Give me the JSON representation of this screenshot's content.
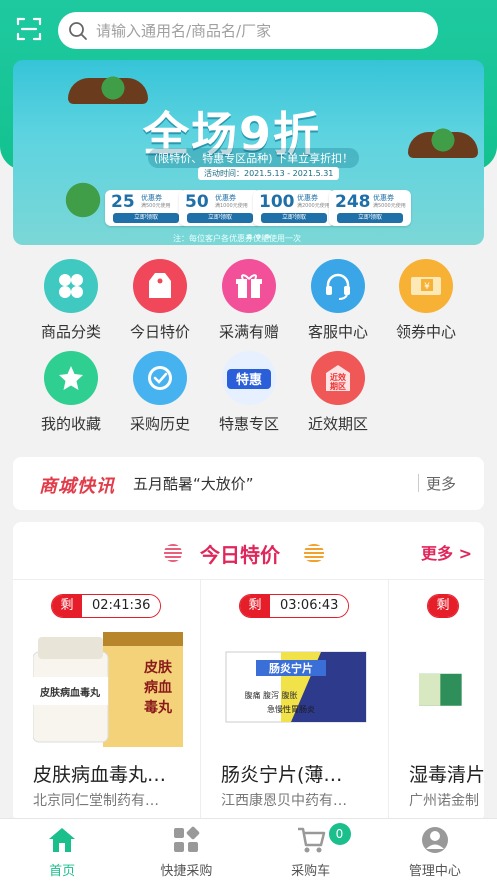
{
  "header": {
    "search_placeholder": "请输入通用名/商品名/厂家"
  },
  "banner": {
    "title": "全场9折",
    "subtitle": "(限特价、特惠专区品种) 下单立享折扣！",
    "date": "活动时间：2021.5.13 - 2021.5.31",
    "coupons": [
      {
        "amount": "25",
        "desc": "优惠券",
        "cond": "满500元使用",
        "btn": "立即领取"
      },
      {
        "amount": "50",
        "desc": "优惠券",
        "cond": "满1000元使用",
        "btn": "立即领取"
      },
      {
        "amount": "100",
        "desc": "优惠券",
        "cond": "满2000元使用",
        "btn": "立即领取"
      },
      {
        "amount": "248",
        "desc": "优惠券",
        "cond": "满5000元使用",
        "btn": "立即领取"
      }
    ],
    "note": "注：每位客户各优惠券仅能使用一次"
  },
  "menu": [
    {
      "label": "商品分类",
      "icon": "grid-icon",
      "color": "#3fc9c0"
    },
    {
      "label": "今日特价",
      "icon": "tag-icon",
      "color": "#f0475a"
    },
    {
      "label": "采满有赠",
      "icon": "gift-icon",
      "color": "#f2519a"
    },
    {
      "label": "客服中心",
      "icon": "headset-icon",
      "color": "#3aa6e8"
    },
    {
      "label": "领券中心",
      "icon": "ticket-icon",
      "color": "#f7b236"
    },
    {
      "label": "我的收藏",
      "icon": "star-icon",
      "color": "#2fcf92"
    },
    {
      "label": "采购历史",
      "icon": "clock-icon",
      "color": "#46b3f0"
    },
    {
      "label": "特惠专区",
      "icon": "special-icon",
      "color": "#2b5fd9"
    },
    {
      "label": "近效期区",
      "icon": "near-expiry-icon",
      "color": "#f05757"
    }
  ],
  "news": {
    "logo": "商城快讯",
    "text": "五月酷暑“大放价”",
    "more": "更多"
  },
  "special": {
    "title": "今日特价",
    "more": "更多 >",
    "tag": "剩",
    "products": [
      {
        "time": "02:41:36",
        "name": "皮肤病血毒丸…",
        "maker": "北京同仁堂制药有…",
        "img_text": "皮肤病血毒丸"
      },
      {
        "time": "03:06:43",
        "name": "肠炎宁片(薄…",
        "maker": "江西康恩贝中药有…",
        "img_text": "肠炎宁片"
      },
      {
        "time": "",
        "name": "湿毒清片",
        "maker": "广州诺金制",
        "img_text": ""
      }
    ]
  },
  "tabbar": {
    "tabs": [
      {
        "label": "首页"
      },
      {
        "label": "快捷采购"
      },
      {
        "label": "采购车"
      },
      {
        "label": "管理中心"
      }
    ],
    "cart_count": "0"
  }
}
